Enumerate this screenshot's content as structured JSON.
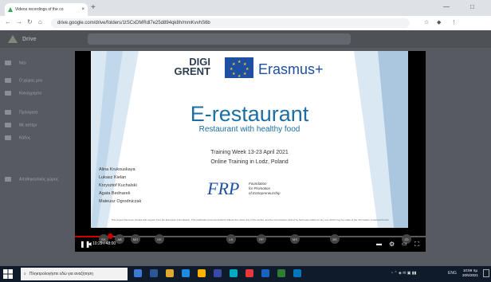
{
  "browser": {
    "tab_title": "Videos recordings of the co",
    "tab_close": "×",
    "new_tab": "+",
    "url": "drive.google.com/drive/folders/1tSCxDMRdl7e25d894qk8h/mmKvvhS6b",
    "window_controls": [
      "•",
      "—",
      "□"
    ]
  },
  "drive": {
    "app_name": "Drive",
    "sidebar": [
      "Νέο",
      "Ο χώρος μου",
      "Κοινόχρηστο",
      "Πρόσφατα",
      "Με αστέρι",
      "Κάδος",
      "Αποθηκευτικός χώρος"
    ]
  },
  "slide": {
    "logo_top": "DIGI",
    "logo_bottom": "GRENT",
    "erasmus": "Erasmus+",
    "title": "E-restaurant",
    "subtitle": "Restaurant with healthy food",
    "training_line1": "Training Week 13-23 April 2021",
    "training_line2": "Online Training in Lodz, Poland",
    "names": [
      "Alina Krukouskaya",
      "Lukasz Kielan",
      "Krzysztof Kuchalski",
      "Agata Bednarek",
      "Mateusz Ogrodniczak"
    ],
    "frp_logo": "FRP",
    "frp_text": [
      "Foundation",
      "for Promotion",
      "of Entrepreneurship"
    ],
    "disclaimer": "This project has been funded with support from the European Commission. This publication [communication] reflects the views only of the author, and the Commission cannot be held responsible for any use which may be made of the information contained therein."
  },
  "player": {
    "time": "10:29 / 48:00",
    "progress": 0.1,
    "participants": [
      "ΕΚ",
      "ΑΒ",
      "ΜΟ",
      "ΚΚ",
      "LK",
      "RP",
      "MS",
      "BS",
      "ZD"
    ]
  },
  "taskbar": {
    "search_placeholder": "Πληκτρολογήστε εδώ για αναζήτηση",
    "tray_lang": "ENG",
    "time": "10:59 πμ",
    "date": "20/5/2021"
  },
  "colors": {
    "accent": "#1d6fa3",
    "progress": "#cc0000",
    "taskbar": "#0f1b2b"
  }
}
